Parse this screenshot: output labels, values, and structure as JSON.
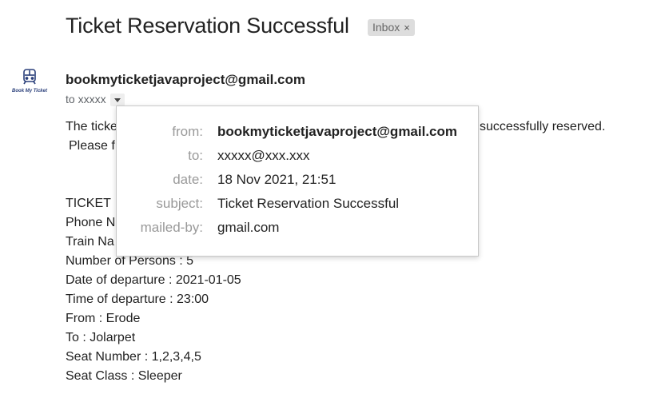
{
  "email": {
    "subject": "Ticket Reservation Successful",
    "label_chip": "Inbox",
    "label_chip_close": "×",
    "sender": "bookmyticketjavaproject@gmail.com",
    "to_line": "to xxxxx",
    "logo_text": "Book My Ticket"
  },
  "body": {
    "line1_start": "The ticke",
    "line1_end": "successfully reserved.",
    "line2": "Please f",
    "details": [
      "TICKET",
      "Phone N",
      "Train Na",
      "Number of Persons : 5",
      "Date of departure : 2021-01-05",
      "Time of departure : 23:00",
      "From : Erode",
      "To : Jolarpet",
      "Seat Number : 1,2,3,4,5",
      "Seat Class : Sleeper"
    ]
  },
  "popup": {
    "rows": [
      {
        "label": "from:",
        "value": "bookmyticketjavaproject@gmail.com"
      },
      {
        "label": "to:",
        "value": "xxxxx@xxx.xxx"
      },
      {
        "label": "date:",
        "value": "18 Nov 2021, 21:51"
      },
      {
        "label": "subject:",
        "value": "Ticket Reservation Successful"
      },
      {
        "label": "mailed-by:",
        "value": "gmail.com"
      }
    ]
  }
}
